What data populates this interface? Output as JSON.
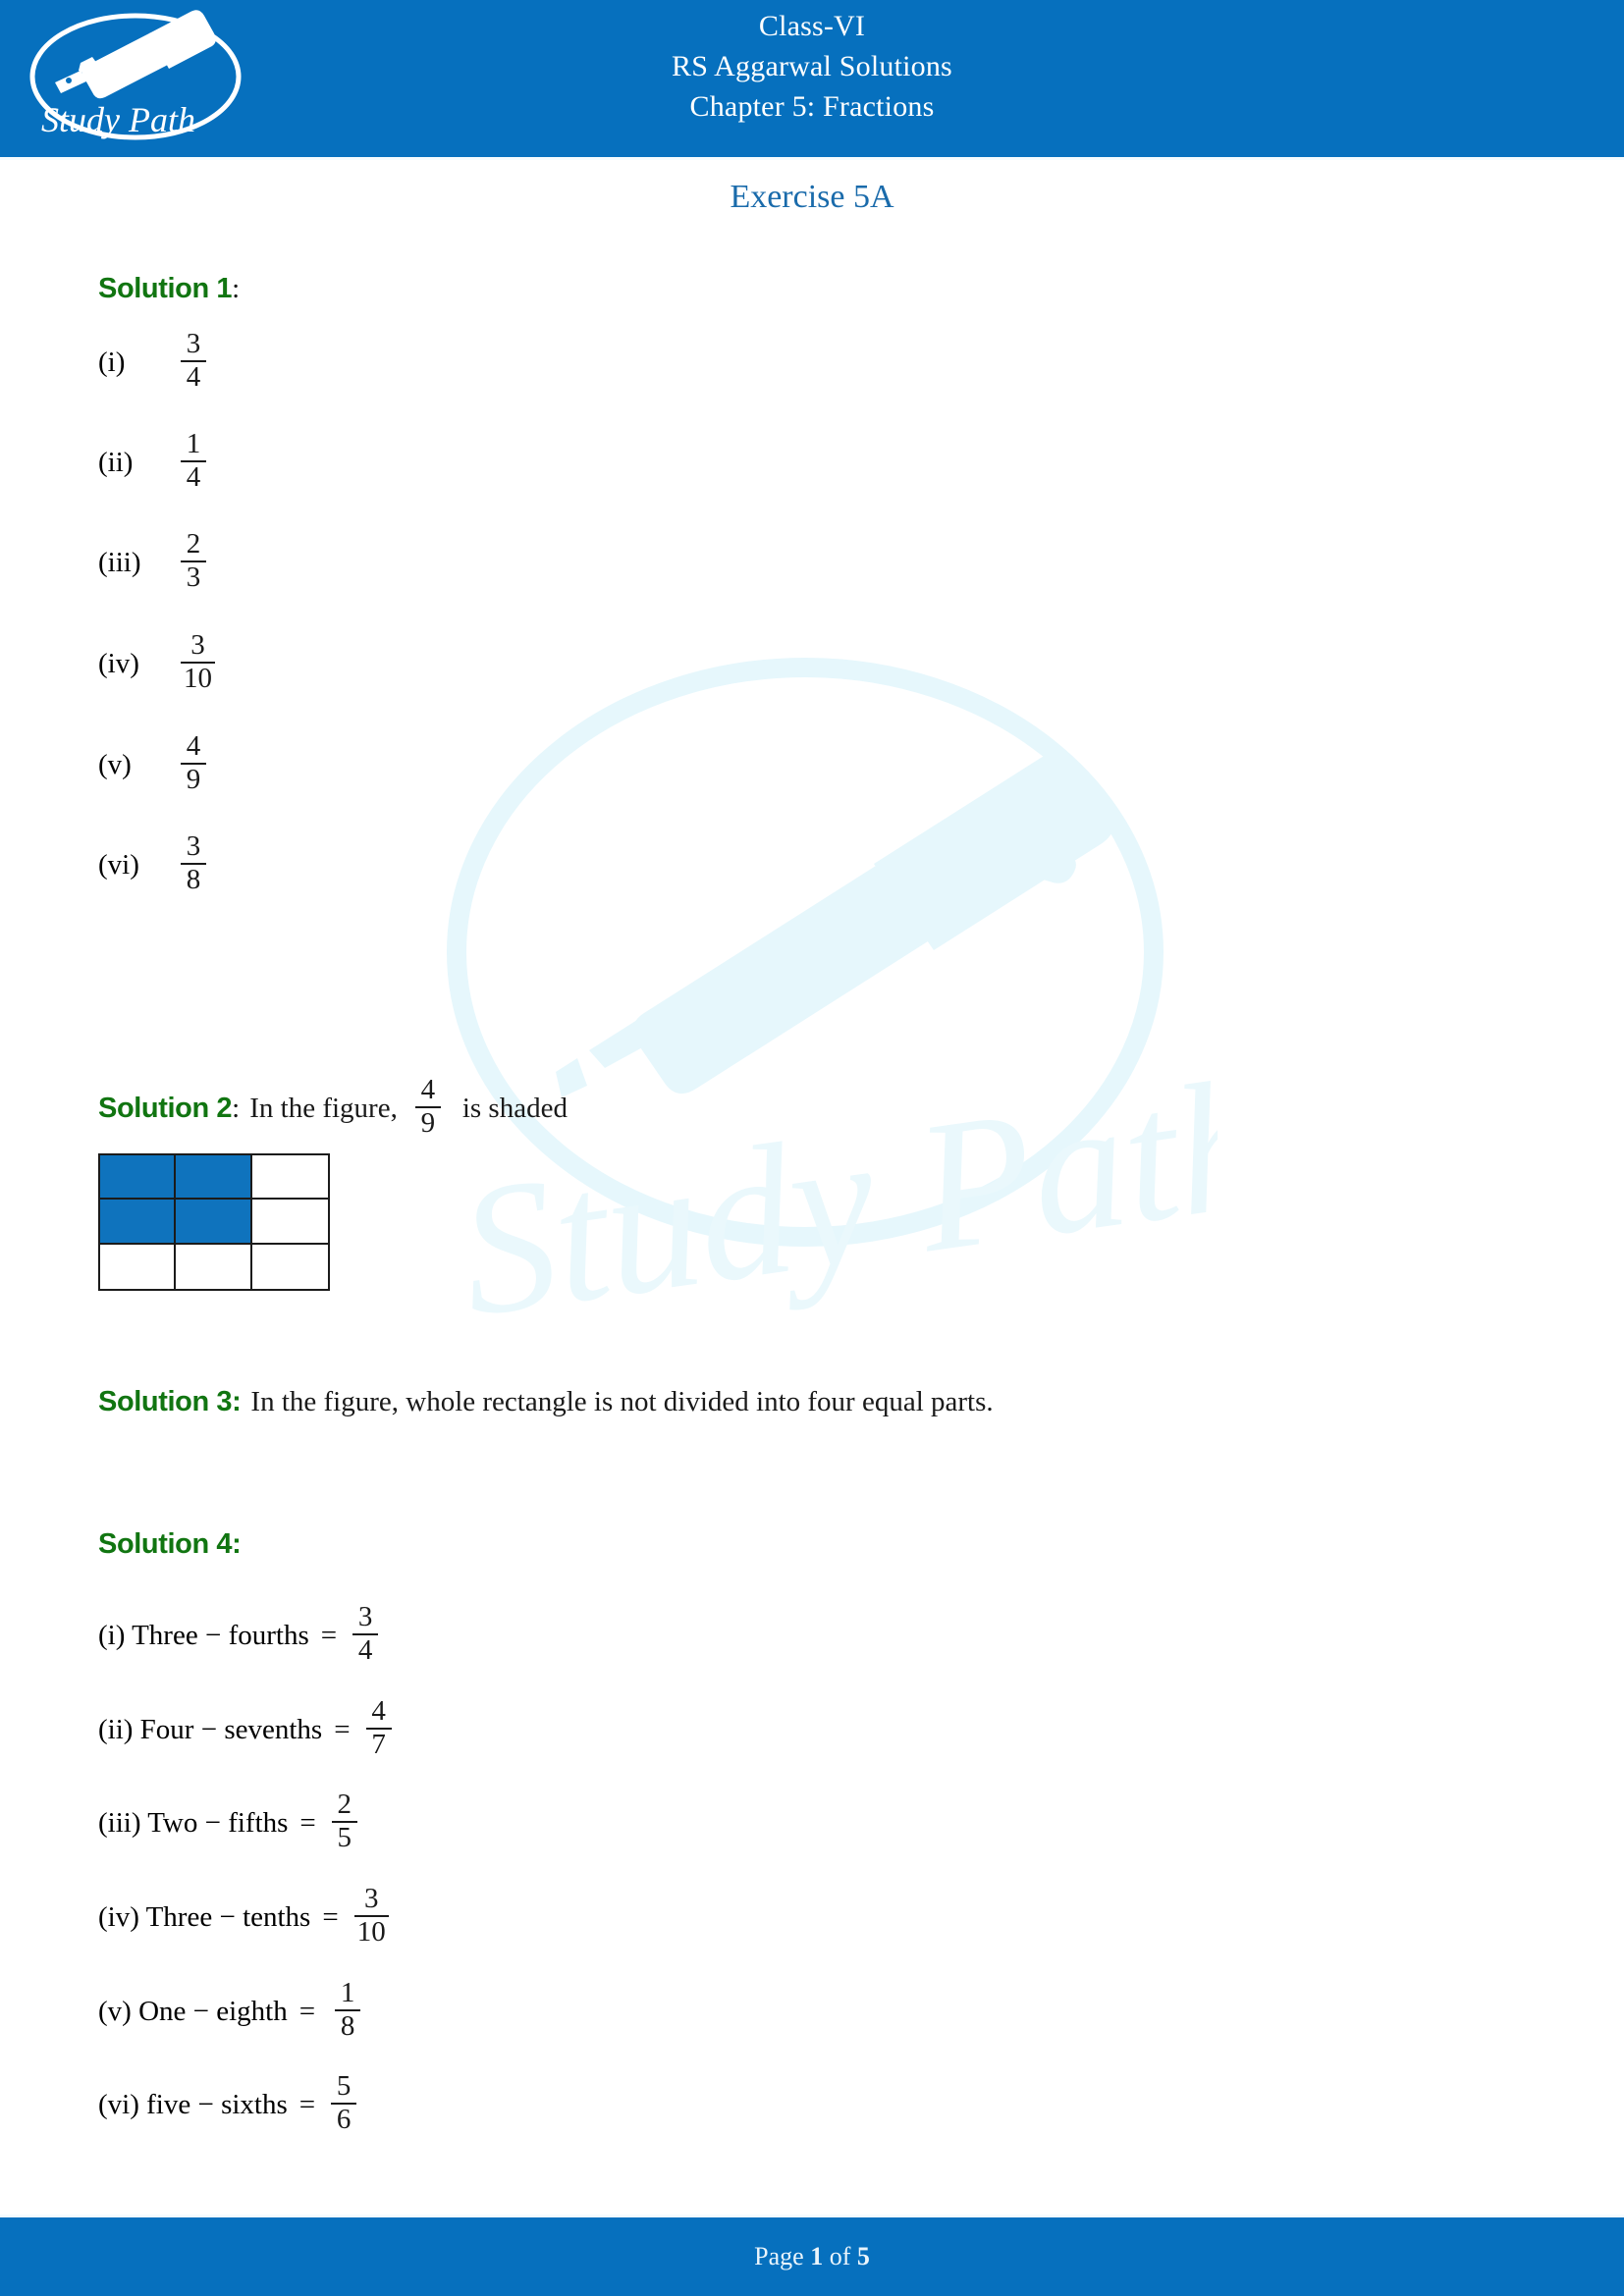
{
  "header": {
    "logo_text": "Study Path",
    "logo_icon": "fountain-pen-icon",
    "line1": "Class-VI",
    "line2": "RS Aggarwal Solutions",
    "line3": "Chapter 5: Fractions",
    "bg_color": "#0670be"
  },
  "watermark": {
    "text": "Study Path",
    "icon": "fountain-pen-icon",
    "color": "#e8f8fc"
  },
  "exercise": {
    "title": "Exercise 5A",
    "color": "#1a6bab"
  },
  "solution1": {
    "heading": "Solution 1",
    "heading_colon": ":",
    "heading_color": "#117511",
    "items": [
      {
        "label": "(i)",
        "num": "3",
        "den": "4"
      },
      {
        "label": "(ii)",
        "num": "1",
        "den": "4"
      },
      {
        "label": "(iii)",
        "num": "2",
        "den": "3"
      },
      {
        "label": "(iv)",
        "num": "3",
        "den": "10"
      },
      {
        "label": "(v)",
        "num": "4",
        "den": "9"
      },
      {
        "label": "(vi)",
        "num": "3",
        "den": "8"
      }
    ]
  },
  "solution2": {
    "heading": "Solution 2",
    "heading_colon": ":",
    "text_before": "In the figure,",
    "fraction_num": "4",
    "fraction_den": "9",
    "text_after": "is shaded",
    "figure": {
      "rows": 3,
      "cols": 3,
      "shaded_cells": 4,
      "shade_color": "#0f73bd",
      "border_color": "#1b1b1b"
    }
  },
  "solution3": {
    "heading": "Solution 3:",
    "text": "In the figure, whole rectangle is not divided into four equal parts."
  },
  "solution4": {
    "heading": "Solution 4:",
    "items": [
      {
        "label": "(i) Three − fourths",
        "eq": "=",
        "num": "3",
        "den": "4"
      },
      {
        "label": "(ii) Four − sevenths",
        "eq": "=",
        "num": "4",
        "den": "7"
      },
      {
        "label": "(iii) Two − fifths",
        "eq": "=",
        "num": "2",
        "den": "5"
      },
      {
        "label": "(iv) Three − tenths",
        "eq": "=",
        "num": "3",
        "den": "10"
      },
      {
        "label": "(v) One − eighth",
        "eq": "=",
        "num": "1",
        "den": "8"
      },
      {
        "label": "(vi) five − sixths",
        "eq": "=",
        "num": "5",
        "den": "6"
      }
    ]
  },
  "footer": {
    "prefix": "Page ",
    "current_page": "1",
    "middle": " of ",
    "total_pages": "5",
    "bg_color": "#0670be"
  }
}
